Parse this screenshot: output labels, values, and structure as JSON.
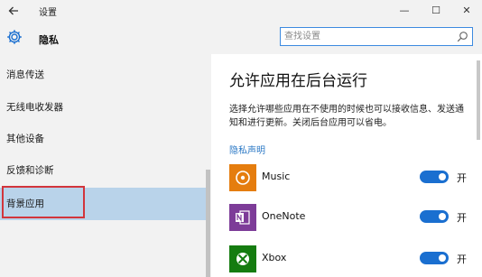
{
  "window": {
    "title": "设置",
    "back_icon": "arrow-left-icon",
    "minimize_symbol": "—",
    "maximize_symbol": "☐",
    "close_symbol": "✕"
  },
  "header": {
    "icon": "gear-icon",
    "title": "隐私"
  },
  "search": {
    "placeholder": "查找设置",
    "value": "",
    "icon": "search-icon"
  },
  "sidebar": {
    "items": [
      {
        "label": "消息传送"
      },
      {
        "label": "无线电收发器"
      },
      {
        "label": "其他设备"
      },
      {
        "label": "反馈和诊断"
      },
      {
        "label": "背景应用",
        "selected": true
      }
    ]
  },
  "main": {
    "heading": "允许应用在后台运行",
    "description": "选择允许哪些应用在不使用的时候也可以接收信息、发送通知和进行更新。关闭后台应用可以省电。",
    "privacy_link": "隐私声明",
    "apps": [
      {
        "name": "Music",
        "toggle_state": "on",
        "toggle_label": "开",
        "tile_color": "#e57d0e",
        "icon": "music-disc-icon"
      },
      {
        "name": "OneNote",
        "toggle_state": "on",
        "toggle_label": "开",
        "tile_color": "#7d3c98",
        "icon": "onenote-icon"
      },
      {
        "name": "Xbox",
        "toggle_state": "on",
        "toggle_label": "开",
        "tile_color": "#157c10",
        "icon": "xbox-icon"
      }
    ]
  },
  "colors": {
    "accent": "#1a6fd0",
    "sidebar_bg": "#f2f2f2",
    "selected_bg": "#b9d3ea",
    "highlight_border": "#d2353c",
    "link": "#2b78c5"
  }
}
